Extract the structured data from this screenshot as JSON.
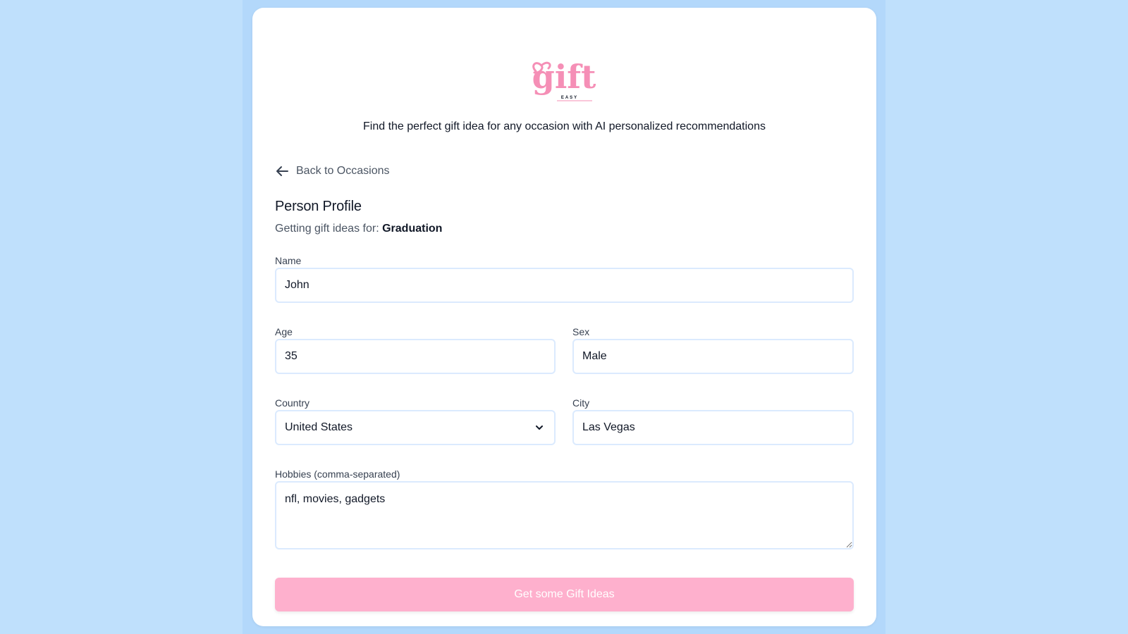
{
  "brand": {
    "logo_text": "gift",
    "logo_subtext": "EASY",
    "tagline": "Find the perfect gift idea for any occasion with AI personalized recommendations"
  },
  "nav": {
    "back_label": "Back to Occasions",
    "back_icon": "arrow-left-icon"
  },
  "profile": {
    "heading": "Person Profile",
    "occasion_prefix": "Getting gift ideas for:",
    "occasion": "Graduation"
  },
  "form": {
    "name": {
      "label": "Name",
      "value": "John"
    },
    "age": {
      "label": "Age",
      "value": "35"
    },
    "sex": {
      "label": "Sex",
      "value": "Male"
    },
    "country": {
      "label": "Country",
      "value": "United States",
      "icon": "chevron-down-icon"
    },
    "city": {
      "label": "City",
      "value": "Las Vegas"
    },
    "hobbies": {
      "label": "Hobbies (comma-separated)",
      "value": "nfl, movies, gadgets"
    }
  },
  "submit_label": "Get some Gift Ideas",
  "colors": {
    "page_bg": "#bfe0fc",
    "column_bg": "#b3d8fb",
    "accent_pink": "#f58fb6",
    "button_bg": "#feb0cd",
    "field_border": "#dbeafe"
  }
}
